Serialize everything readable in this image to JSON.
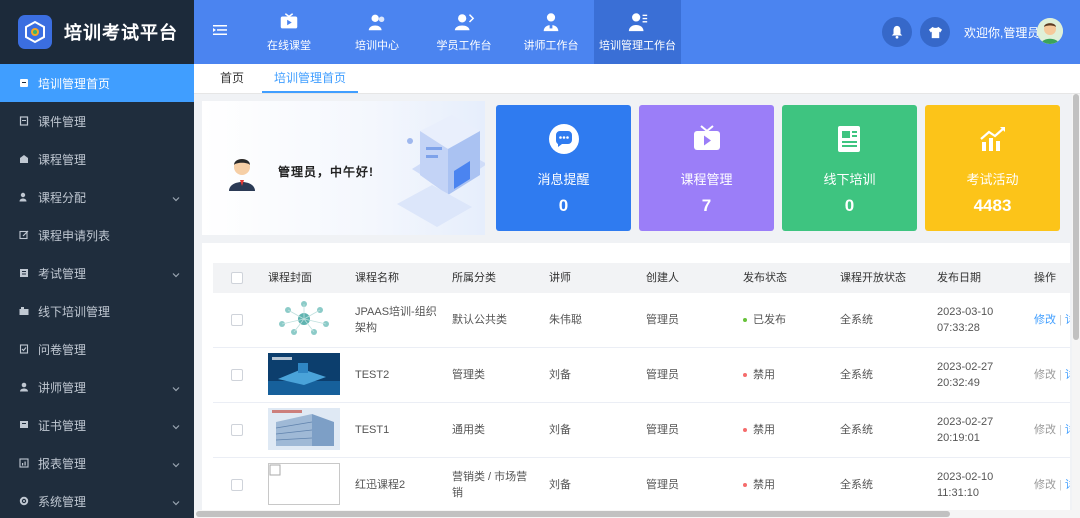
{
  "brand": {
    "title": "培训考试平台"
  },
  "sidebar": {
    "items": [
      {
        "label": "培训管理首页",
        "icon": "home-icon",
        "active": true,
        "has_children": false
      },
      {
        "label": "课件管理",
        "icon": "courseware-icon",
        "has_children": false
      },
      {
        "label": "课程管理",
        "icon": "course-icon",
        "has_children": false
      },
      {
        "label": "课程分配",
        "icon": "assign-icon",
        "has_children": true
      },
      {
        "label": "课程申请列表",
        "icon": "edit-icon",
        "has_children": false
      },
      {
        "label": "考试管理",
        "icon": "exam-icon",
        "has_children": true
      },
      {
        "label": "线下培训管理",
        "icon": "offline-icon",
        "has_children": false
      },
      {
        "label": "问卷管理",
        "icon": "survey-icon",
        "has_children": false
      },
      {
        "label": "讲师管理",
        "icon": "teacher-icon",
        "has_children": true
      },
      {
        "label": "证书管理",
        "icon": "certificate-icon",
        "has_children": true
      },
      {
        "label": "报表管理",
        "icon": "report-icon",
        "has_children": true
      },
      {
        "label": "系统管理",
        "icon": "settings-icon",
        "has_children": true
      }
    ]
  },
  "topnav": {
    "tabs": [
      {
        "label": "在线课堂",
        "icon": "tv-icon"
      },
      {
        "label": "培训中心",
        "icon": "users-icon"
      },
      {
        "label": "学员工作台",
        "icon": "student-icon"
      },
      {
        "label": "讲师工作台",
        "icon": "teacher-icon"
      },
      {
        "label": "培训管理工作台",
        "icon": "manager-icon",
        "active": true
      }
    ],
    "welcome": "欢迎你,管理员"
  },
  "breadcrumb": {
    "items": [
      "首页",
      "培训管理首页"
    ]
  },
  "greeting": {
    "text": "管理员，中午好!"
  },
  "stats": [
    {
      "label": "消息提醒",
      "value": "0",
      "color": "#2f7bf0",
      "icon": "message-icon"
    },
    {
      "label": "课程管理",
      "value": "7",
      "color": "#9b7ef8",
      "icon": "tv-icon"
    },
    {
      "label": "线下培训",
      "value": "0",
      "color": "#3ec480",
      "icon": "news-icon"
    },
    {
      "label": "考试活动",
      "value": "4483",
      "color": "#fcc419",
      "icon": "chart-icon"
    }
  ],
  "table": {
    "headers": [
      "课程封面",
      "课程名称",
      "所属分类",
      "讲师",
      "创建人",
      "发布状态",
      "课程开放状态",
      "发布日期",
      "操作"
    ],
    "rows": [
      {
        "name": "JPAAS培训-组织架构",
        "category": "默认公共类",
        "teacher": "朱伟聪",
        "creator": "管理员",
        "status": "已发布",
        "status_color": "#67c23a",
        "open": "全系统",
        "date": "2023-03-10",
        "time": "07:33:28",
        "edit": "修改",
        "more": "详"
      },
      {
        "name": "TEST2",
        "category": "管理类",
        "teacher": "刘备",
        "creator": "管理员",
        "status": "禁用",
        "status_color": "#f56c6c",
        "open": "全系统",
        "date": "2023-02-27",
        "time": "20:32:49",
        "edit": "修改",
        "more": "详"
      },
      {
        "name": "TEST1",
        "category": "通用类",
        "teacher": "刘备",
        "creator": "管理员",
        "status": "禁用",
        "status_color": "#f56c6c",
        "open": "全系统",
        "date": "2023-02-27",
        "time": "20:19:01",
        "edit": "修改",
        "more": "详"
      },
      {
        "name": "红迅课程2",
        "category": "营销类 / 市场营销",
        "teacher": "刘备",
        "creator": "管理员",
        "status": "禁用",
        "status_color": "#f56c6c",
        "open": "全系统",
        "date": "2023-02-10",
        "time": "11:31:10",
        "edit": "修改",
        "more": "详"
      }
    ]
  }
}
